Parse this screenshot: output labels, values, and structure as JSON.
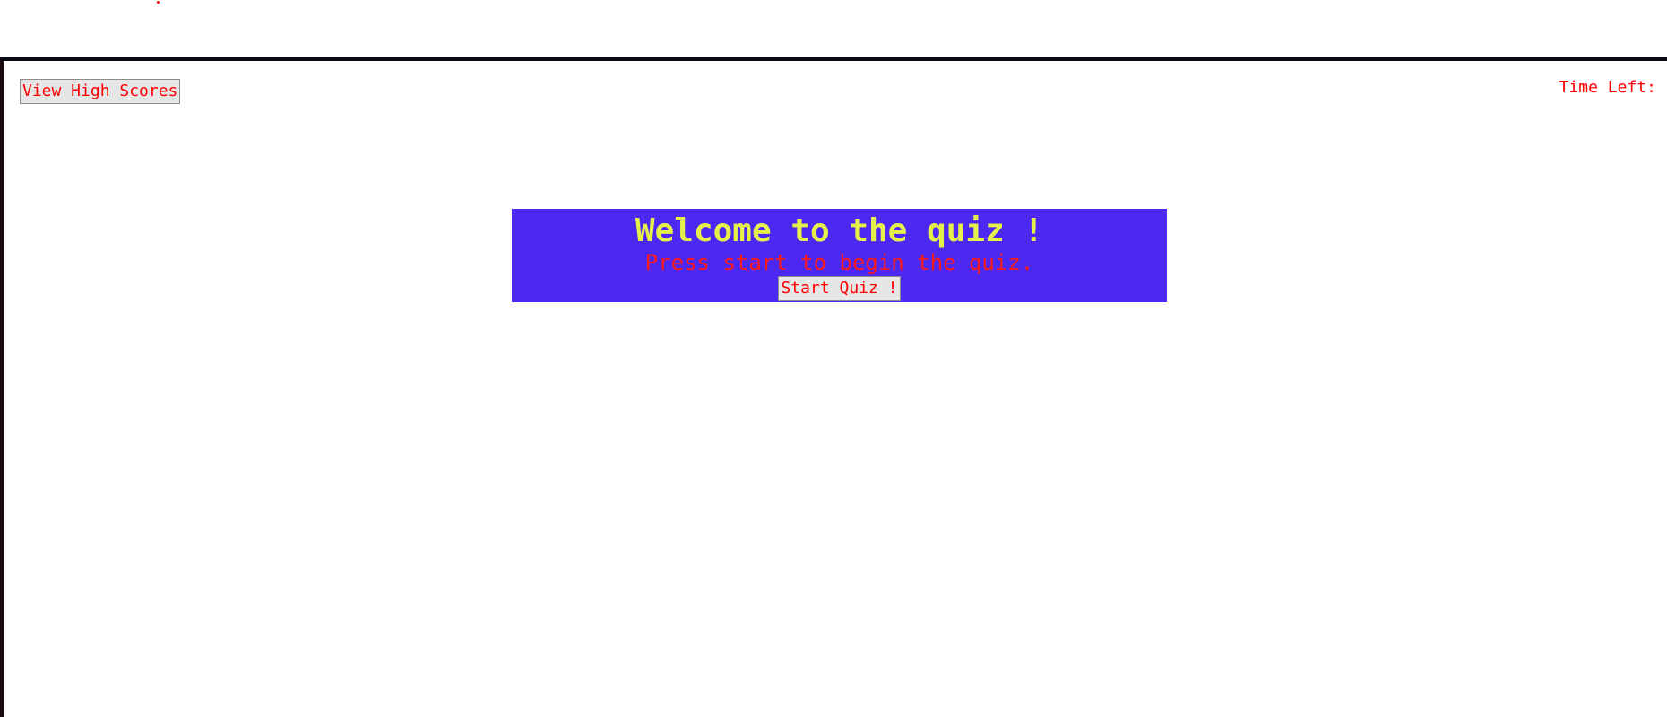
{
  "header": {
    "high_scores_label": "View High Scores",
    "time_left_label": "Time Left:"
  },
  "welcome": {
    "title": "Welcome to the quiz !",
    "subtitle": "Press start to begin the quiz.",
    "start_label": "Start Quiz !"
  },
  "colors": {
    "accent_red": "#ff0000",
    "panel_bg": "#4c28f0",
    "title_yellow": "#e6f04a",
    "button_bg": "#e6e6e6"
  }
}
